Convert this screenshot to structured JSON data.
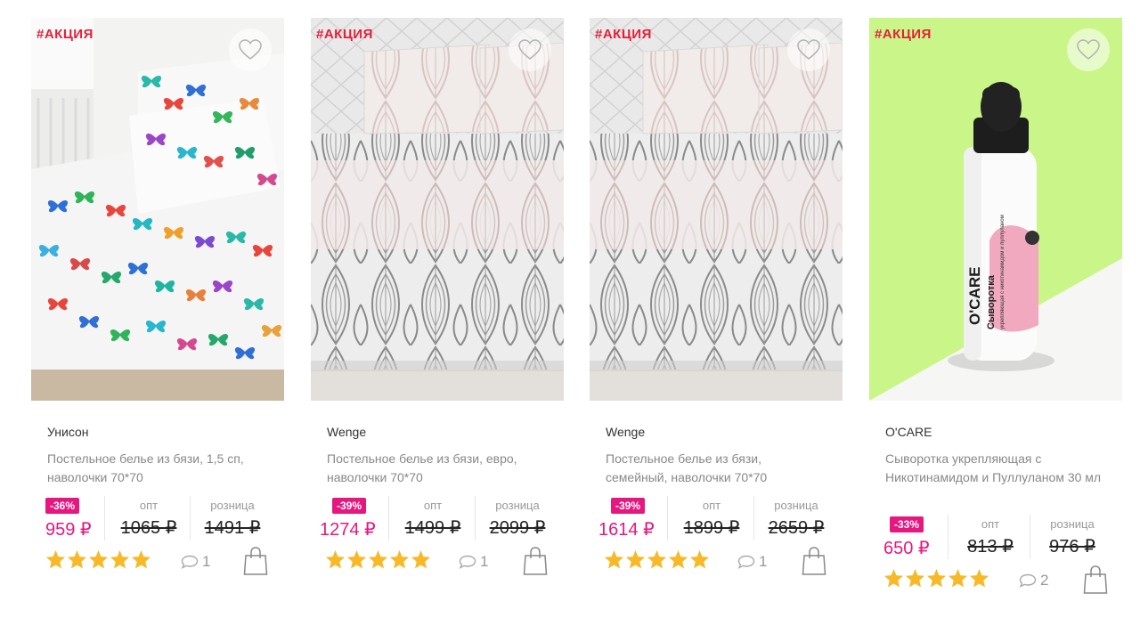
{
  "colors": {
    "accent": "#e6177f",
    "promo": "#e5203a",
    "star": "#f7b928"
  },
  "icons": {
    "favorite": "heart-icon",
    "comments": "comment-bubble-icon",
    "cart": "shopping-bag-icon",
    "rating": "star-icon"
  },
  "products": [
    {
      "promo": "#АКЦИЯ",
      "brand": "Унисон",
      "title": "Постельное белье из бязи, 1,5 сп, наволочки 70*70",
      "discount": "-36%",
      "price": "959 ₽",
      "opt_label": "опт",
      "opt_price": "1065 ₽",
      "retail_label": "розница",
      "retail_price": "1491 ₽",
      "rating": 5,
      "comments": "1"
    },
    {
      "promo": "#АКЦИЯ",
      "brand": "Wenge",
      "title": "Постельное белье из бязи, евро, наволочки 70*70",
      "discount": "-39%",
      "price": "1274 ₽",
      "opt_label": "опт",
      "opt_price": "1499 ₽",
      "retail_label": "розница",
      "retail_price": "2099 ₽",
      "rating": 5,
      "comments": "1"
    },
    {
      "promo": "#АКЦИЯ",
      "brand": "Wenge",
      "title": "Постельное белье из бязи, семейный, наволочки 70*70",
      "discount": "-39%",
      "price": "1614 ₽",
      "opt_label": "опт",
      "opt_price": "1899 ₽",
      "retail_label": "розница",
      "retail_price": "2659 ₽",
      "rating": 5,
      "comments": "1"
    },
    {
      "promo": "#АКЦИЯ",
      "brand": "O'CARE",
      "title": "Сыворотка укрепляющая с Никотинамидом и Пуллуланом 30 мл",
      "discount": "-33%",
      "price": "650 ₽",
      "opt_label": "опт",
      "opt_price": "813 ₽",
      "retail_label": "розница",
      "retail_price": "976 ₽",
      "rating": 5,
      "comments": "2",
      "bottle_brand": "O'CARE",
      "bottle_label": "Сыворотка",
      "bottle_sub": "укрепляющая с никотинамидом и пуллуланом"
    }
  ]
}
